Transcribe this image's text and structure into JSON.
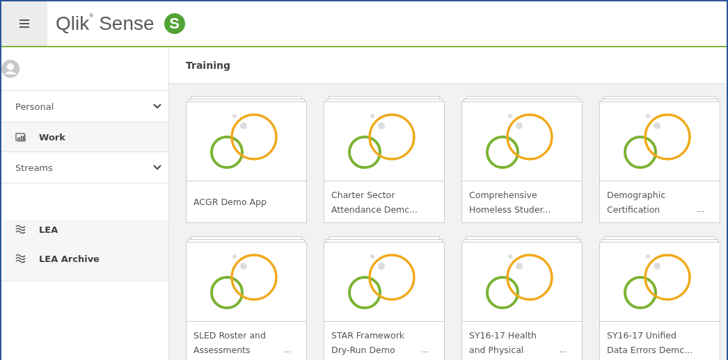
{
  "header": {
    "logo_text": "Qlik",
    "logo_mark": "®",
    "product": "Sense",
    "badge": "S"
  },
  "sidebar": {
    "sections": [
      {
        "kind": "group",
        "label": "Personal",
        "expanded": false
      },
      {
        "kind": "app",
        "label": "Work"
      },
      {
        "kind": "group",
        "label": "Streams",
        "expanded": false
      },
      {
        "kind": "spacer"
      },
      {
        "kind": "stream",
        "label": "LEA"
      },
      {
        "kind": "stream",
        "label": "LEA Archive"
      }
    ]
  },
  "main": {
    "title": "Training",
    "apps": [
      {
        "title_lines": [
          "ACGR Demo App"
        ]
      },
      {
        "title_lines": [
          "Charter Sector",
          "Attendance Demc..."
        ]
      },
      {
        "title_lines": [
          "Comprehensive",
          "Homeless Studer..."
        ]
      },
      {
        "title_lines": [
          "Demographic",
          "Certification"
        ],
        "more": "..."
      },
      {
        "title_lines": [
          "SLED Roster and",
          "Assessments"
        ],
        "more": "..."
      },
      {
        "title_lines": [
          "STAR Framework",
          "Dry-Run Demo"
        ],
        "more": "..."
      },
      {
        "title_lines": [
          "SY16-17 Health",
          "and Physical"
        ],
        "more": "..."
      },
      {
        "title_lines": [
          "SY16-17 Unified",
          "Data Errors Demc..."
        ]
      }
    ]
  }
}
